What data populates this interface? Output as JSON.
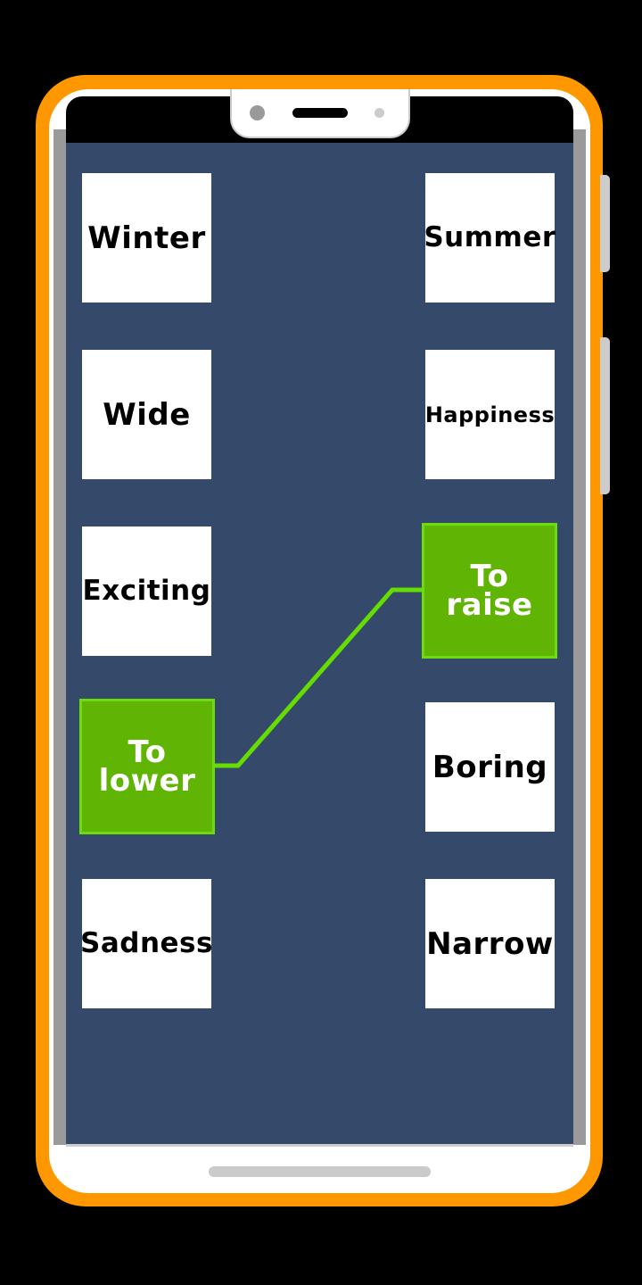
{
  "colors": {
    "frame": "#ff9800",
    "screen": "#35496b",
    "selected": "#5fb404",
    "connector": "#66dd00"
  },
  "left_column": [
    {
      "label": "Winter",
      "selected": false
    },
    {
      "label": "Wide",
      "selected": false
    },
    {
      "label": "Exciting",
      "selected": false
    },
    {
      "label": "To lower",
      "selected": true
    },
    {
      "label": "Sadness",
      "selected": false
    }
  ],
  "right_column": [
    {
      "label": "Summer",
      "selected": false
    },
    {
      "label": "Happiness",
      "selected": false
    },
    {
      "label": "To raise",
      "selected": true
    },
    {
      "label": "Boring",
      "selected": false
    },
    {
      "label": "Narrow",
      "selected": false
    }
  ],
  "connection": {
    "from": "To lower",
    "to": "To raise"
  }
}
